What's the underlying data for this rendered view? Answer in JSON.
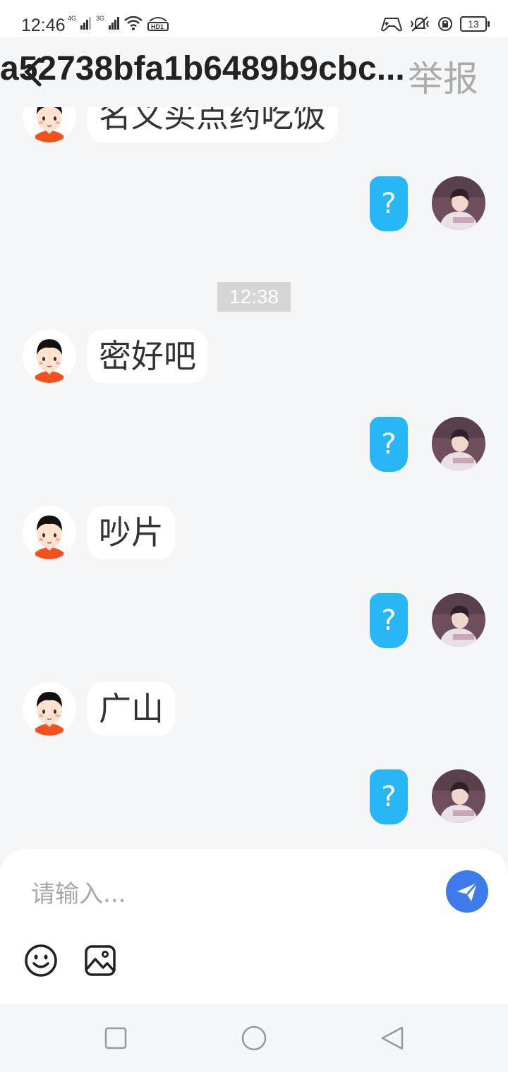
{
  "status_bar": {
    "time": "12:46",
    "net_1": "4G",
    "net_2": "3G",
    "battery": "13"
  },
  "header": {
    "title": "a52738bfa1b6489b9cbc...",
    "report_label": "举报"
  },
  "timestamp": "12:38",
  "messages": [
    {
      "side": "left",
      "text": "名义买点药吃饭"
    },
    {
      "side": "right",
      "text": "?"
    },
    {
      "side": "left",
      "text": "密好吧"
    },
    {
      "side": "right",
      "text": "?"
    },
    {
      "side": "left",
      "text": "吵片"
    },
    {
      "side": "right",
      "text": "?"
    },
    {
      "side": "left",
      "text": "广山"
    },
    {
      "side": "right",
      "text": "?"
    }
  ],
  "input": {
    "placeholder": "请输入..."
  },
  "colors": {
    "accent_blue": "#29b6f6",
    "send_blue": "#3d7bea",
    "background": "#f4f6f8"
  },
  "icons": {
    "back": "back-arrow-icon",
    "send": "send-icon",
    "emoji": "emoji-icon",
    "image": "image-icon",
    "nav_recent": "square-icon",
    "nav_home": "circle-icon",
    "nav_back": "triangle-back-icon"
  }
}
